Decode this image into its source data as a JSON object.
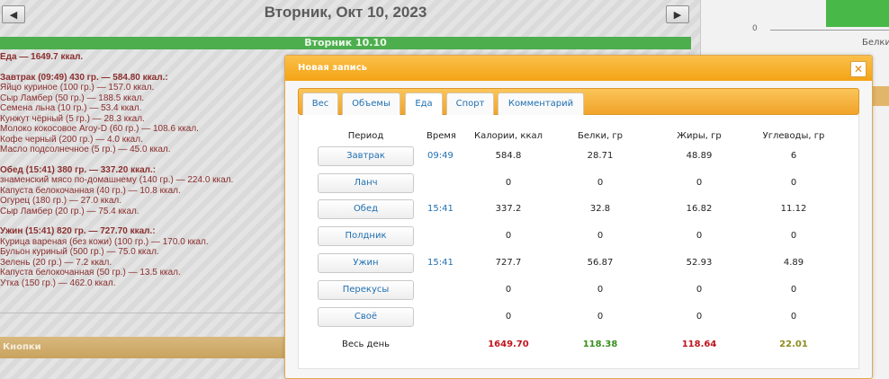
{
  "header": {
    "date_title": "Вторник, Окт 10, 2023",
    "prev_icon": "triangle-left-icon",
    "next_icon": "triangle-right-icon",
    "day_bar": "Вторник 10.10"
  },
  "food_log": {
    "lines": [
      {
        "text": "Еда — 1649.7 ккал.",
        "head": true
      },
      {
        "gap": true
      },
      {
        "text": "Завтрак (09:49) 430 гр. — 584.80 ккал.:",
        "head": true
      },
      {
        "text": "Яйцо куриное (100 гр.) — 157.0 ккал."
      },
      {
        "text": "Сыр Ламбер (50 гр.) — 188.5 ккал."
      },
      {
        "text": "Семена льна (10 гр.) — 53.4 ккал."
      },
      {
        "text": "Кунжут чёрный (5 гр.) — 28.3 ккал."
      },
      {
        "text": "Молоко кокосовое Aroy-D (60 гр.) — 108.6 ккал."
      },
      {
        "text": "Кофе черный (200 гр.) — 4.0 ккал."
      },
      {
        "text": "Масло подсолнечное (5 гр.) — 45.0 ккал."
      },
      {
        "gap": true
      },
      {
        "text": "Обед (15:41) 380 гр. — 337.20 ккал.:",
        "head": true
      },
      {
        "text": "знаменский мясо по-домашнему (140 гр.) — 224.0 ккал."
      },
      {
        "text": "Капуста белокочанная (40 гр.) — 10.8 ккал."
      },
      {
        "text": "Огурец (180 гр.) — 27.0 ккал."
      },
      {
        "text": "Сыр Ламбер (20 гр.) — 75.4 ккал."
      },
      {
        "gap": true
      },
      {
        "text": "Ужин (15:41) 820 гр. — 727.70 ккал.:",
        "head": true
      },
      {
        "text": "Курица вареная (без кожи) (100 гр.) — 170.0 ккал."
      },
      {
        "text": "Бульон куриный (500 гр.) — 75.0 ккал."
      },
      {
        "text": "Зелень (20 гр.) — 7.2 ккал."
      },
      {
        "text": "Капуста белокочанная (50 гр.) — 13.5 ккал."
      },
      {
        "text": "Утка (150 гр.) — 462.0 ккал."
      }
    ]
  },
  "buttons_section": "Кнопки",
  "side_chart": {
    "zero_label": "0",
    "label": "Белки",
    "bar_color": "#48b948"
  },
  "dialog": {
    "title": "Новая запись",
    "close_icon": "close-x-icon",
    "tabs": [
      {
        "label": "Вес",
        "active": false
      },
      {
        "label": "Объемы",
        "active": false
      },
      {
        "label": "Еда",
        "active": true
      },
      {
        "label": "Спорт",
        "active": false
      },
      {
        "label": "Комментарий",
        "active": false
      }
    ],
    "columns": [
      "Период",
      "Время",
      "Калории, ккал",
      "Белки, гр",
      "Жиры, гр",
      "Углеводы, гр"
    ],
    "rows": [
      {
        "period": "Завтрак",
        "time": "09:49",
        "kcal": "584.8",
        "protein": "28.71",
        "fat": "48.89",
        "carbs": "6"
      },
      {
        "period": "Ланч",
        "time": "",
        "kcal": "0",
        "protein": "0",
        "fat": "0",
        "carbs": "0"
      },
      {
        "period": "Обед",
        "time": "15:41",
        "kcal": "337.2",
        "protein": "32.8",
        "fat": "16.82",
        "carbs": "11.12"
      },
      {
        "period": "Полдник",
        "time": "",
        "kcal": "0",
        "protein": "0",
        "fat": "0",
        "carbs": "0"
      },
      {
        "period": "Ужин",
        "time": "15:41",
        "kcal": "727.7",
        "protein": "56.87",
        "fat": "52.93",
        "carbs": "4.89"
      },
      {
        "period": "Перекусы",
        "time": "",
        "kcal": "0",
        "protein": "0",
        "fat": "0",
        "carbs": "0"
      },
      {
        "period": "Своё",
        "time": "",
        "kcal": "0",
        "protein": "0",
        "fat": "0",
        "carbs": "0"
      }
    ],
    "total": {
      "label": "Весь день",
      "kcal": "1649.70",
      "protein": "118.38",
      "fat": "118.64",
      "carbs": "22.01",
      "colors": {
        "kcal": "#c0141e",
        "protein": "#3a8f1f",
        "fat": "#c0141e",
        "carbs": "#8c8c1e"
      }
    }
  }
}
